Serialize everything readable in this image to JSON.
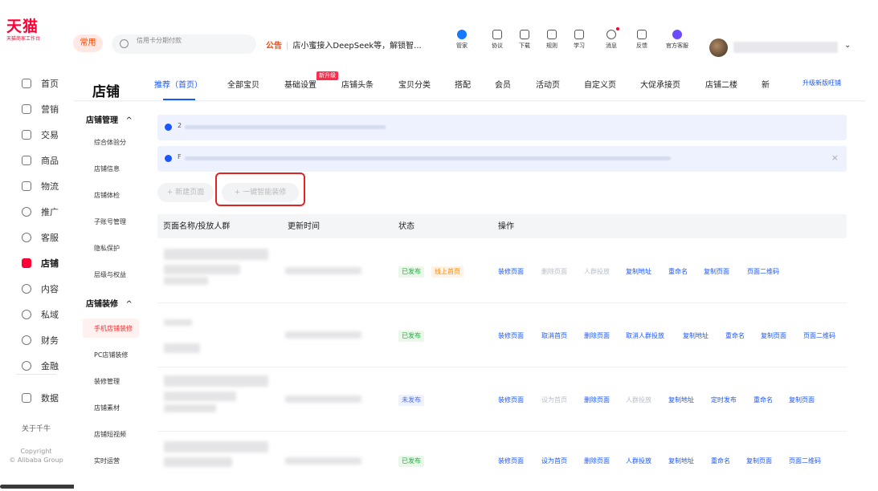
{
  "brand": {
    "logo": "天猫",
    "subtitle": "天猫商家工作台",
    "red": "#ff0036",
    "blue": "#1a56ff"
  },
  "header": {
    "common_label": "常用",
    "search_placeholder": "信用卡分期付款",
    "notice_tag": "公告",
    "notice_text": "店小蜜接入DeepSeek等，解锁智...",
    "tools": [
      {
        "label": "管家",
        "icon": "butler-icon"
      },
      {
        "label": "协议",
        "icon": "agreement-icon"
      },
      {
        "label": "下载",
        "icon": "download-icon"
      },
      {
        "label": "规则",
        "icon": "rules-icon"
      },
      {
        "label": "学习",
        "icon": "study-icon"
      },
      {
        "label": "消息",
        "icon": "message-icon"
      },
      {
        "label": "反馈",
        "icon": "feedback-icon"
      },
      {
        "label": "官方客服",
        "icon": "service-icon"
      }
    ]
  },
  "leftnav": {
    "items": [
      {
        "label": "首页",
        "icon": "home-icon"
      },
      {
        "label": "营销",
        "icon": "marketing-icon"
      },
      {
        "label": "交易",
        "icon": "trade-icon"
      },
      {
        "label": "商品",
        "icon": "goods-icon"
      },
      {
        "label": "物流",
        "icon": "logistics-icon"
      },
      {
        "label": "推广",
        "icon": "promotion-icon"
      },
      {
        "label": "客服",
        "icon": "customer-service-icon"
      },
      {
        "label": "店铺",
        "icon": "store-icon"
      },
      {
        "label": "内容",
        "icon": "content-icon"
      },
      {
        "label": "私域",
        "icon": "private-domain-icon"
      },
      {
        "label": "财务",
        "icon": "finance-icon"
      },
      {
        "label": "金融",
        "icon": "banking-icon"
      },
      {
        "label": "数据",
        "icon": "data-icon"
      }
    ],
    "active": "店铺",
    "footer": {
      "about": "关于千牛",
      "copyright": "Copyright",
      "company": "© Alibaba Group"
    }
  },
  "store": {
    "title": "店铺",
    "tabs": [
      "推荐（首页）",
      "全部宝贝",
      "基础设置",
      "店铺头条",
      "宝贝分类",
      "搭配",
      "会员",
      "活动页",
      "自定义页",
      "大促承接页",
      "店铺二楼",
      "新"
    ],
    "active_tab": "推荐（首页）",
    "new_badge": "新升级",
    "upgrade_link": "升级新版旺铺"
  },
  "subnav": {
    "groups": [
      {
        "title": "店铺管理",
        "caret": "^",
        "items": [
          "综合体验分",
          "店铺信息",
          "店铺体检",
          "子账号管理",
          "隐私保护",
          "层级与权益"
        ]
      },
      {
        "title": "店铺装修",
        "caret": "^",
        "items": [
          "手机店铺装修",
          "PC店铺装修",
          "装修管理",
          "店铺素材",
          "店铺短视频",
          "实时运营"
        ]
      }
    ],
    "active": "手机店铺装修"
  },
  "content": {
    "info1_prefix": "2",
    "info2_prefix": "F",
    "close_icon": "×",
    "btn_new_page": "+ 新建页面",
    "btn_smart": "+ 一键智能装修",
    "columns": [
      "页面名称/投放人群",
      "更新时间",
      "状态",
      "操作"
    ],
    "rows": [
      {
        "status": [
          "已发布",
          "线上首页"
        ],
        "ops": [
          "装修页面",
          "删除页面",
          "人群投放",
          "复制地址",
          "重命名",
          "复制页面",
          "页面二维码"
        ]
      },
      {
        "status": [
          "已发布"
        ],
        "ops": [
          "装修页面",
          "取消首页",
          "删除页面",
          "取消人群投放",
          "复制地址",
          "重命名",
          "复制页面",
          "页面二维码"
        ]
      },
      {
        "status": [
          "未发布"
        ],
        "ops": [
          "装修页面",
          "设为首页",
          "删除页面",
          "人群投放",
          "复制地址",
          "定时发布",
          "重命名",
          "复制页面"
        ]
      },
      {
        "status": [
          "已发布"
        ],
        "ops": [
          "装修页面",
          "设为首页",
          "删除页面",
          "人群投放",
          "复制地址",
          "重命名",
          "复制页面",
          "页面二维码"
        ]
      }
    ]
  }
}
